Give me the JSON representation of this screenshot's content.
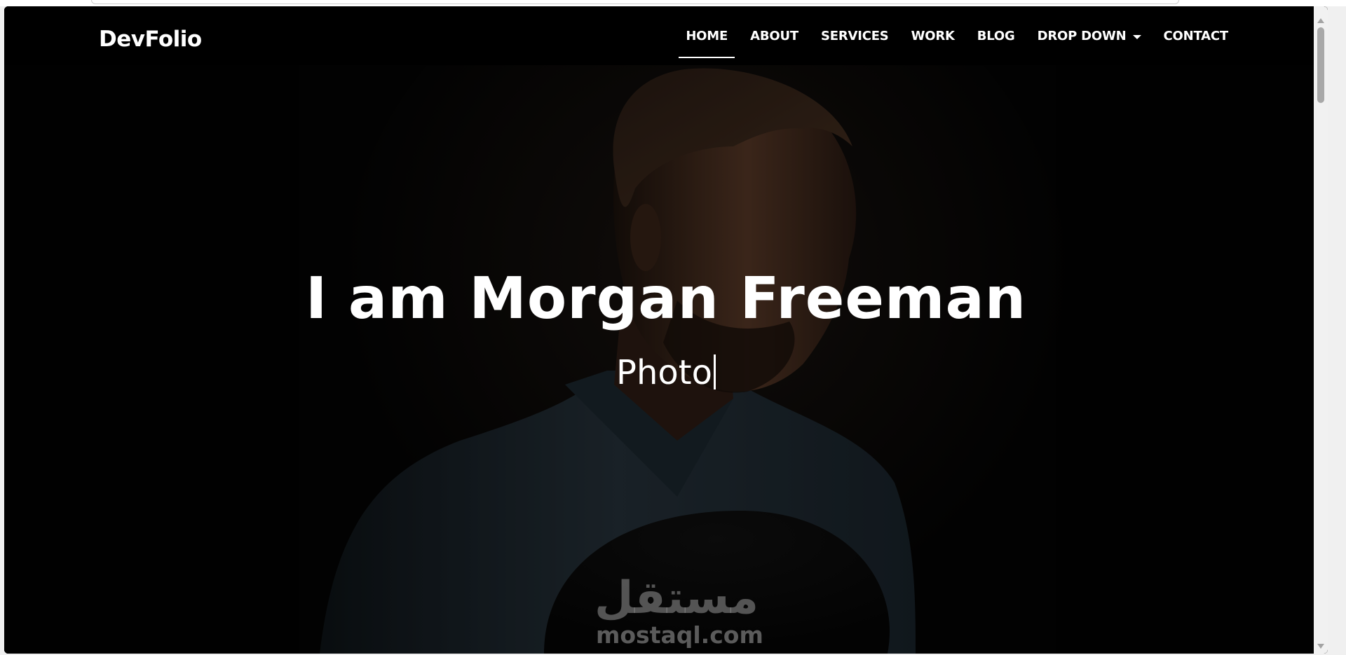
{
  "brand": {
    "name": "DevFolio"
  },
  "nav": {
    "items": [
      {
        "label": "HOME",
        "active": true
      },
      {
        "label": "ABOUT",
        "active": false
      },
      {
        "label": "SERVICES",
        "active": false
      },
      {
        "label": "WORK",
        "active": false
      },
      {
        "label": "BLOG",
        "active": false
      },
      {
        "label": "DROP DOWN",
        "active": false,
        "icon": "caret-down-icon"
      },
      {
        "label": "CONTACT",
        "active": false
      }
    ]
  },
  "hero": {
    "title": "I am Morgan Freeman",
    "typed_text": "Photo"
  },
  "watermark": {
    "arabic": "مستقل",
    "latin": "mostaql.com"
  },
  "colors": {
    "background": "#000000",
    "text": "#ffffff",
    "watermark": "#969696",
    "scrollbar_track": "#f1f1f1",
    "scrollbar_thumb": "#a8a8a8"
  }
}
